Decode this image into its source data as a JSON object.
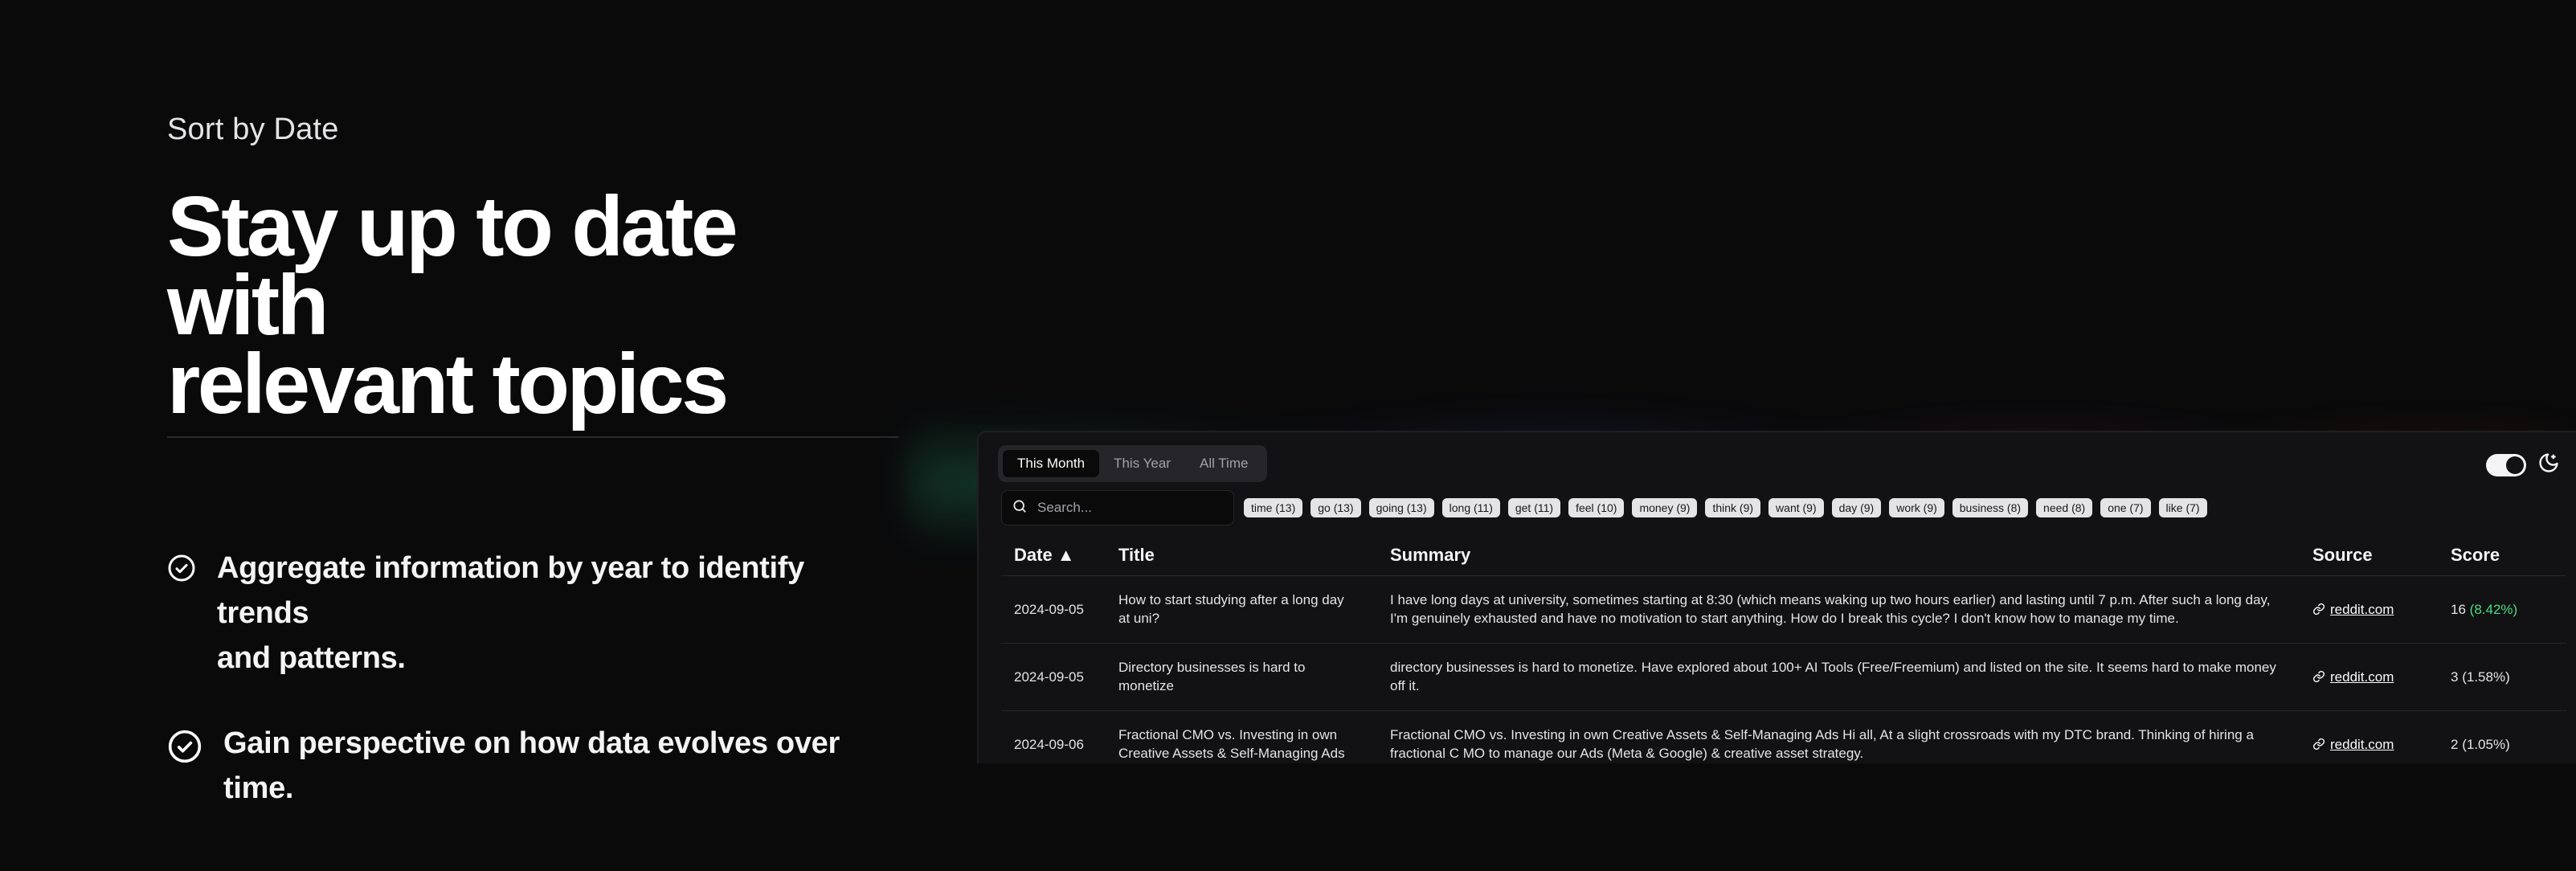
{
  "hero": {
    "eyebrow": "Sort by Date",
    "headline_line1": "Stay up to date with",
    "headline_line2": "relevant topics",
    "features": [
      {
        "icon": "check-circle-icon",
        "line1": "Aggregate information by year to identify trends",
        "line2": "and patterns."
      },
      {
        "icon": "check-circle-icon",
        "line1": "Gain perspective on how data evolves over time."
      }
    ]
  },
  "panel": {
    "tabs": [
      {
        "label": "This Month",
        "active": true
      },
      {
        "label": "This Year",
        "active": false
      },
      {
        "label": "All Time",
        "active": false
      }
    ],
    "theme_toggle_icon": "moon-icon",
    "search": {
      "placeholder": "Search...",
      "value": ""
    },
    "keywords": [
      "time (13)",
      "go (13)",
      "going (13)",
      "long (11)",
      "get (11)",
      "feel (10)",
      "money (9)",
      "think (9)",
      "want (9)",
      "day (9)",
      "work (9)",
      "business (8)",
      "need (8)",
      "one (7)",
      "like (7)"
    ],
    "table": {
      "headers": {
        "date": "Date ▲",
        "title": "Title",
        "summary": "Summary",
        "source": "Source",
        "score": "Score"
      },
      "rows": [
        {
          "date": "2024-09-05",
          "title_l1": "How to start studying after a long day",
          "title_l2": "at uni?",
          "summary_l1": "I have long days at university, sometimes starting at 8:30 (which means waking up two hours earlier) and lasting until 7 p.m. After such a long day,",
          "summary_l2": "I'm genuinely exhausted and have no motivation to start anything. How do I break this cycle? I don't know how to manage my time.",
          "source": "reddit.com",
          "score": "16",
          "score_pct": "(8.42%)"
        },
        {
          "date": "2024-09-05",
          "title_l1": "Directory businesses is hard to",
          "title_l2": "monetize",
          "summary_l1": "directory businesses is hard to monetize. Have explored about 100+ AI Tools (Free/Freemium) and listed on the site. It seems hard to make money",
          "summary_l2": "off it.",
          "source": "reddit.com",
          "score": "3",
          "score_pct": "(1.58%)"
        },
        {
          "date": "2024-09-06",
          "title_l1": "Fractional CMO vs. Investing in own",
          "title_l2": "Creative Assets & Self-Managing Ads",
          "summary_l1": "Fractional CMO vs. Investing in own Creative Assets & Self-Managing Ads Hi all, At a slight crossroads with my DTC brand. Thinking of hiring a",
          "summary_l2": "fractional C MO to manage our Ads (Meta & Google) & creative asset strategy.",
          "source": "reddit.com",
          "score": "2",
          "score_pct": "(1.05%)"
        }
      ]
    }
  }
}
